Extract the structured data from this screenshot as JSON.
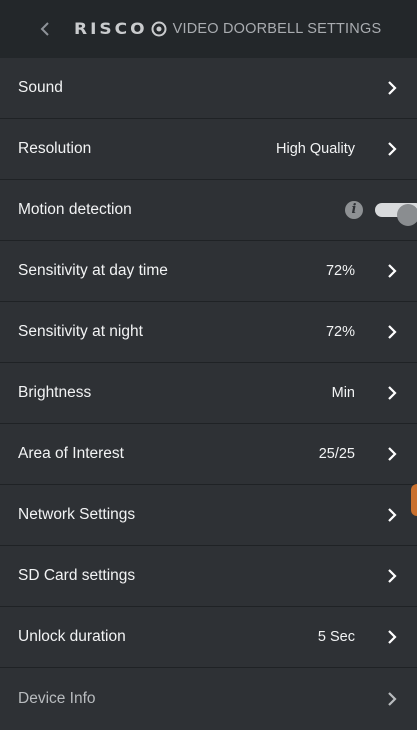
{
  "header": {
    "logo": "RISCO",
    "title": "VIDEO DOORBELL SETTINGS",
    "back_icon": "chevron-left-icon"
  },
  "settings": {
    "sound": {
      "label": "Sound"
    },
    "resolution": {
      "label": "Resolution",
      "value": "High Quality"
    },
    "motion_detection": {
      "label": "Motion detection",
      "info_glyph": "i",
      "enabled": true
    },
    "sensitivity_day": {
      "label": "Sensitivity at day time",
      "value": "72%"
    },
    "sensitivity_night": {
      "label": "Sensitivity at night",
      "value": "72%"
    },
    "brightness": {
      "label": "Brightness",
      "value": "Min"
    },
    "area_of_interest": {
      "label": "Area of Interest",
      "value": "25/25"
    },
    "network_settings": {
      "label": "Network Settings"
    },
    "sd_card_settings": {
      "label": "SD Card settings"
    },
    "unlock_duration": {
      "label": "Unlock duration",
      "value": "5 Sec"
    },
    "device_info": {
      "label": "Device Info"
    }
  },
  "colors": {
    "background": "#2e3135",
    "header_bg": "#23272a",
    "divider": "#1f2225",
    "text": "#f2f3f4",
    "accent": "#c9702e"
  }
}
